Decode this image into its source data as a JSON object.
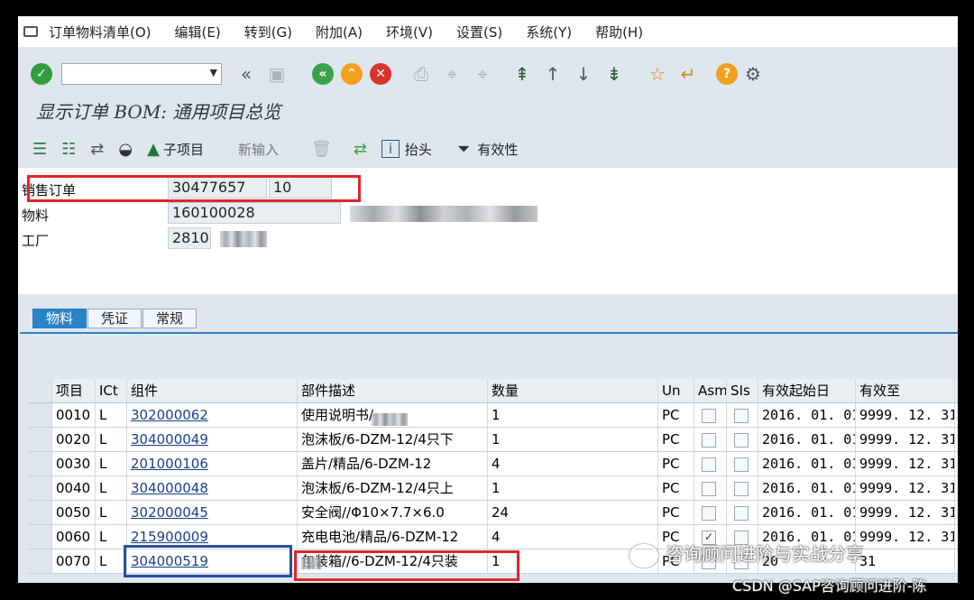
{
  "menu": [
    "订单物料清单(O)",
    "编辑(E)",
    "转到(G)",
    "附加(A)",
    "环境(V)",
    "设置(S)",
    "系统(Y)",
    "帮助(H)"
  ],
  "page_title": "显示订单 BOM: 通用项目总览",
  "app_toolbar": {
    "sub_item_label": "子项目",
    "new_entry_label": "新输入",
    "header_label": "抬头",
    "validity_label": "有效性"
  },
  "header": {
    "sales_order_label": "销售订单",
    "sales_order": "30477657",
    "sales_item": "10",
    "material_label": "物料",
    "material": "160100028",
    "plant_label": "工厂",
    "plant": "2810"
  },
  "tabs": [
    "物料",
    "凭证",
    "常规"
  ],
  "table": {
    "columns": [
      "项目",
      "ICt",
      "组件",
      "部件描述",
      "数量",
      "Un",
      "Asm",
      "SIs",
      "有效起始日",
      "有效至"
    ],
    "rows": [
      {
        "item": "0010",
        "ict": "L",
        "component": "302000062",
        "desc": "使用说明书/",
        "qty": "1",
        "un": "PC",
        "asm": "",
        "valid_from": "2016. 01. 01",
        "valid_to": "9999. 12. 31"
      },
      {
        "item": "0020",
        "ict": "L",
        "component": "304000049",
        "desc": "泡沫板/6-DZM-12/4只下",
        "qty": "1",
        "un": "PC",
        "asm": "",
        "valid_from": "2016. 01. 01",
        "valid_to": "9999. 12. 31"
      },
      {
        "item": "0030",
        "ict": "L",
        "component": "201000106",
        "desc": "盖片/精品/6-DZM-12",
        "qty": "4",
        "un": "PC",
        "asm": "",
        "valid_from": "2016. 01. 01",
        "valid_to": "9999. 12. 31"
      },
      {
        "item": "0040",
        "ict": "L",
        "component": "304000048",
        "desc": "泡沫板/6-DZM-12/4只上",
        "qty": "1",
        "un": "PC",
        "asm": "",
        "valid_from": "2016. 01. 01",
        "valid_to": "9999. 12. 31"
      },
      {
        "item": "0050",
        "ict": "L",
        "component": "302000045",
        "desc": "安全阀//Φ10×7.7×6.0",
        "qty": "24",
        "un": "PC",
        "asm": "",
        "valid_from": "2016. 01. 01",
        "valid_to": "9999. 12. 31"
      },
      {
        "item": "0060",
        "ict": "L",
        "component": "215900009",
        "desc": "充电电池/精品/6-DZM-12",
        "qty": "4",
        "un": "PC",
        "asm": "✓",
        "valid_from": "2016. 01. 01",
        "valid_to": "9999. 12. 31"
      },
      {
        "item": "0070",
        "ict": "L",
        "component": "304000519",
        "desc": "包装箱//6-DZM-12/4只装",
        "qty": "1",
        "un": "PC",
        "asm": "",
        "valid_from": "20",
        "valid_to": "31"
      }
    ]
  },
  "watermark": {
    "line1": "咨询顾问进阶与实战分享",
    "line2": "CSDN @SAP咨询顾问进阶-陈"
  },
  "colors": {
    "accent": "#2b83c6",
    "highlight_red": "#e0262b",
    "highlight_blue": "#2a4f9a",
    "link": "#1a3e8c"
  }
}
